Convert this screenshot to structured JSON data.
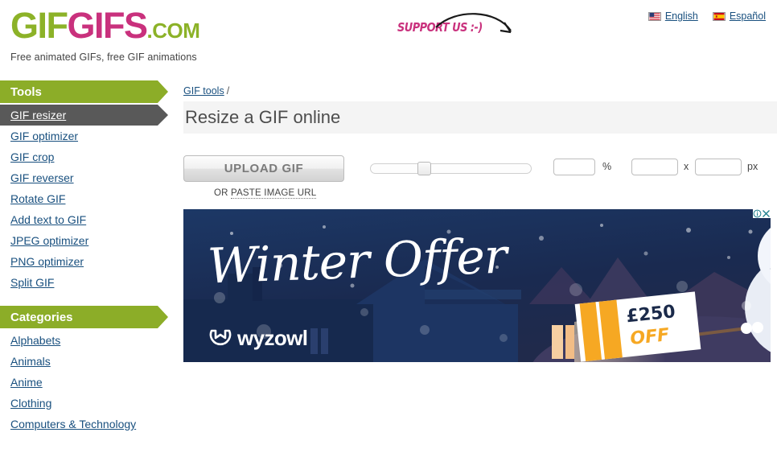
{
  "header": {
    "logo": {
      "part1": "GIF",
      "part2": "GIFS",
      "suffix": ".COM"
    },
    "tagline": "Free animated GIFs, free GIF animations",
    "support_text": "SUPPORT US :-)",
    "languages": [
      {
        "label": "English",
        "flag": "us-flag-icon"
      },
      {
        "label": "Español",
        "flag": "es-flag-icon"
      }
    ]
  },
  "sidebar": {
    "tools_heading": "Tools",
    "tools": [
      {
        "label": "GIF resizer",
        "active": true
      },
      {
        "label": "GIF optimizer",
        "active": false
      },
      {
        "label": "GIF crop",
        "active": false
      },
      {
        "label": "GIF reverser",
        "active": false
      },
      {
        "label": "Rotate GIF",
        "active": false
      },
      {
        "label": "Add text to GIF",
        "active": false
      },
      {
        "label": "JPEG optimizer",
        "active": false
      },
      {
        "label": "PNG optimizer",
        "active": false
      },
      {
        "label": "Split GIF",
        "active": false
      }
    ],
    "categories_heading": "Categories",
    "categories": [
      {
        "label": "Alphabets"
      },
      {
        "label": "Animals"
      },
      {
        "label": "Anime"
      },
      {
        "label": "Clothing"
      },
      {
        "label": "Computers & Technology"
      }
    ]
  },
  "main": {
    "breadcrumb": {
      "link": "GIF tools",
      "separator": "/"
    },
    "page_title": "Resize a GIF online",
    "upload_button": "UPLOAD GIF",
    "paste_prefix": "OR ",
    "paste_link": "PASTE IMAGE URL",
    "slider": {
      "value_percent": 32
    },
    "percent_field": {
      "value": "",
      "unit": "%"
    },
    "width_field": {
      "value": ""
    },
    "dimension_separator": "x",
    "height_field": {
      "value": ""
    },
    "px_unit": "px"
  },
  "ad": {
    "headline": "Winter Offer",
    "brand": "wyzowl",
    "price_amount": "£250",
    "price_off": "OFF",
    "info_icon": "adchoices-info-icon",
    "close_icon": "ad-close-icon"
  },
  "colors": {
    "logo_green": "#8CB228",
    "logo_magenta": "#C9317D",
    "nav_green": "#8CAD28",
    "nav_active_gray": "#595959",
    "link_blue": "#19507F",
    "title_bar_bg": "#f4f4f4",
    "ad_navy": "#182a4e",
    "ad_gold": "#F6A823"
  }
}
